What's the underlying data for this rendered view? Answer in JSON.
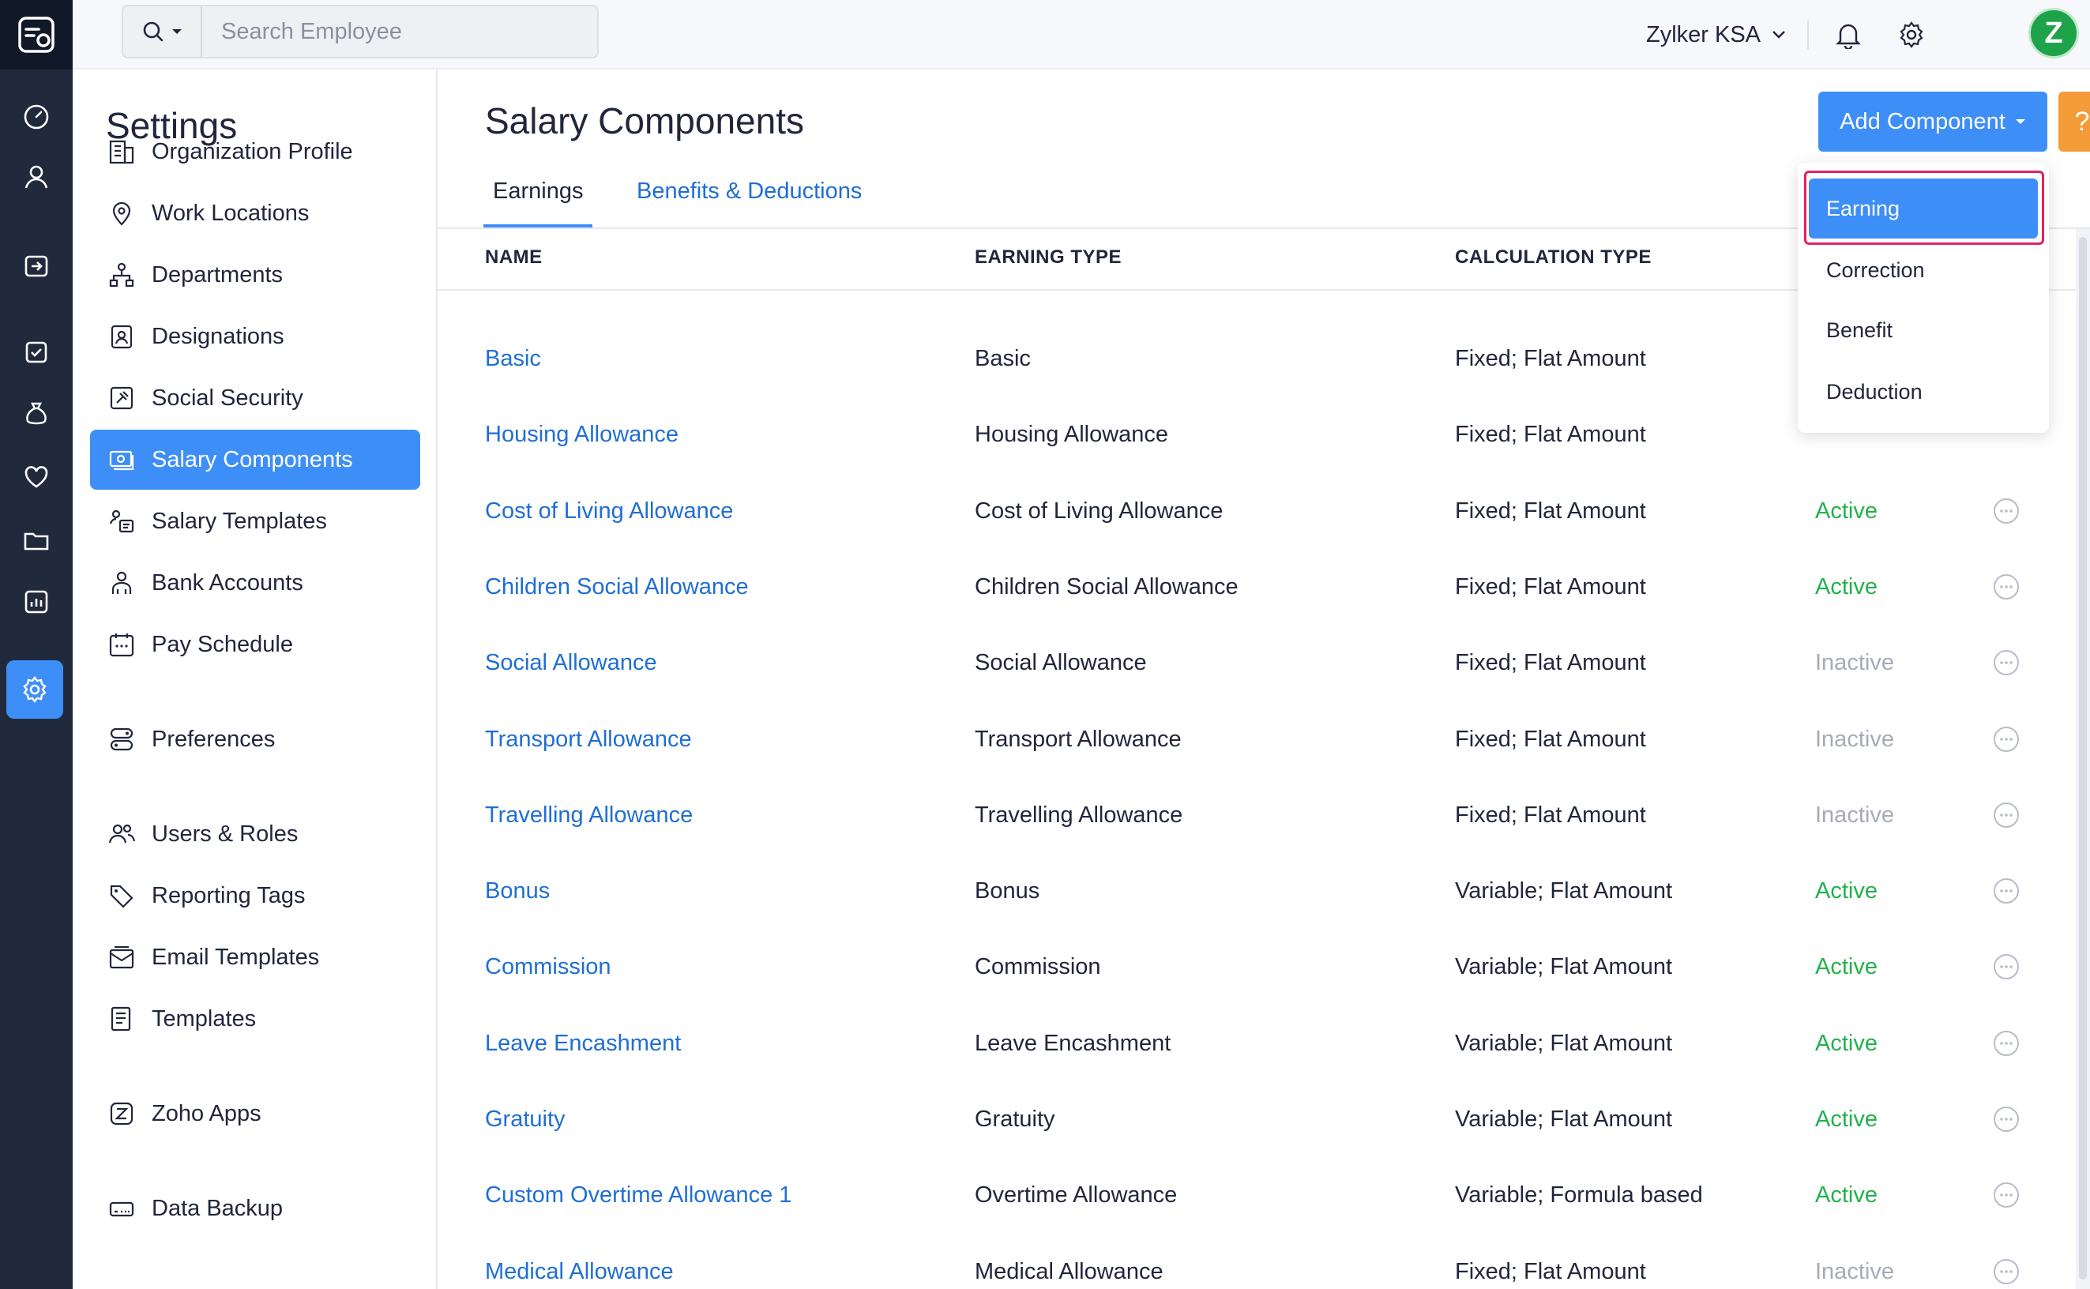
{
  "topbar": {
    "search_placeholder": "Search Employee",
    "org_name": "Zylker KSA",
    "avatar_letter": "Z"
  },
  "settings": {
    "title": "Settings",
    "items": [
      {
        "label": "Organization Profile",
        "icon": "building-icon"
      },
      {
        "label": "Work Locations",
        "icon": "location-pin-icon"
      },
      {
        "label": "Departments",
        "icon": "org-chart-icon"
      },
      {
        "label": "Designations",
        "icon": "id-badge-icon"
      },
      {
        "label": "Social Security",
        "icon": "shield-icon"
      },
      {
        "label": "Salary Components",
        "icon": "money-icon",
        "active": true
      },
      {
        "label": "Salary Templates",
        "icon": "template-icon"
      },
      {
        "label": "Bank Accounts",
        "icon": "bank-user-icon"
      },
      {
        "label": "Pay Schedule",
        "icon": "calendar-icon"
      },
      {
        "label": "Preferences",
        "icon": "toggle-icon"
      },
      {
        "label": "Users & Roles",
        "icon": "users-icon"
      },
      {
        "label": "Reporting Tags",
        "icon": "tag-icon"
      },
      {
        "label": "Email Templates",
        "icon": "email-icon"
      },
      {
        "label": "Templates",
        "icon": "document-icon"
      },
      {
        "label": "Zoho Apps",
        "icon": "zoho-icon"
      },
      {
        "label": "Data Backup",
        "icon": "drive-icon"
      }
    ]
  },
  "main": {
    "title": "Salary Components",
    "tabs": [
      {
        "label": "Earnings",
        "active": true
      },
      {
        "label": "Benefits & Deductions",
        "active": false
      }
    ],
    "add_button": "Add Component",
    "help_button": "?",
    "columns": [
      "NAME",
      "EARNING TYPE",
      "CALCULATION TYPE"
    ],
    "rows": [
      {
        "name": "Basic",
        "type": "Basic",
        "calc": "Fixed; Flat Amount",
        "status": ""
      },
      {
        "name": "Housing Allowance",
        "type": "Housing Allowance",
        "calc": "Fixed; Flat Amount",
        "status": ""
      },
      {
        "name": "Cost of Living Allowance",
        "type": "Cost of Living Allowance",
        "calc": "Fixed; Flat Amount",
        "status": "Active"
      },
      {
        "name": "Children Social Allowance",
        "type": "Children Social Allowance",
        "calc": "Fixed; Flat Amount",
        "status": "Active"
      },
      {
        "name": "Social Allowance",
        "type": "Social Allowance",
        "calc": "Fixed; Flat Amount",
        "status": "Inactive"
      },
      {
        "name": "Transport Allowance",
        "type": "Transport Allowance",
        "calc": "Fixed; Flat Amount",
        "status": "Inactive"
      },
      {
        "name": "Travelling Allowance",
        "type": "Travelling Allowance",
        "calc": "Fixed; Flat Amount",
        "status": "Inactive"
      },
      {
        "name": "Bonus",
        "type": "Bonus",
        "calc": "Variable; Flat Amount",
        "status": "Active"
      },
      {
        "name": "Commission",
        "type": "Commission",
        "calc": "Variable; Flat Amount",
        "status": "Active"
      },
      {
        "name": "Leave Encashment",
        "type": "Leave Encashment",
        "calc": "Variable; Flat Amount",
        "status": "Active"
      },
      {
        "name": "Gratuity",
        "type": "Gratuity",
        "calc": "Variable; Flat Amount",
        "status": "Active"
      },
      {
        "name": "Custom Overtime Allowance 1",
        "type": "Overtime Allowance",
        "calc": "Variable; Formula based",
        "status": "Active"
      },
      {
        "name": "Medical Allowance",
        "type": "Medical Allowance",
        "calc": "Fixed; Flat Amount",
        "status": "Inactive"
      }
    ]
  },
  "dropdown": {
    "items": [
      "Earning",
      "Correction",
      "Benefit",
      "Deduction"
    ],
    "selected": "Earning"
  },
  "colors": {
    "accent": "#3e8ef7",
    "link": "#1f6ed4",
    "active_status": "#23b14d",
    "inactive_status": "#a7abb6",
    "rail_bg": "#212a3d",
    "highlight_border": "#e0245e"
  }
}
